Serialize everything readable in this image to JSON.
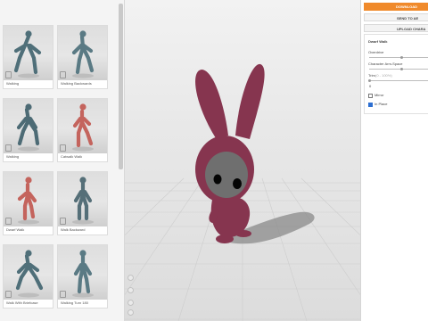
{
  "library": {
    "cards": [
      {
        "label": "Walking",
        "skin": "#4f6f79"
      },
      {
        "label": "Walking Backwards",
        "skin": "#5a7a84"
      },
      {
        "label": "Walking",
        "skin": "#4d6b75"
      },
      {
        "label": "Catwalk Walk",
        "skin": "#c4645d"
      },
      {
        "label": "Dwarf Walk",
        "skin": "#c4645d"
      },
      {
        "label": "Walk Backward",
        "skin": "#556f78"
      },
      {
        "label": "Walk With Briefcase",
        "skin": "#4f6f79"
      },
      {
        "label": "Walking Turn 180",
        "skin": "#5a7a84"
      }
    ]
  },
  "viewport": {
    "character_color": "#86354f",
    "face_color": "#6f6f6f"
  },
  "panel": {
    "download_label": "DOWNLOAD",
    "send_label": "SEND TO AE",
    "upload_label": "UPLOAD CHARA",
    "animation_title": "Dwarf Walk",
    "settings": [
      {
        "label": "Overdrive",
        "value": 0.5
      },
      {
        "label": "Character Arm-Space",
        "value": 0.5
      },
      {
        "label": "Trim",
        "value": 0.0
      }
    ],
    "trim_hint": "(0 - 100%)",
    "trim_value_text": "0",
    "mirror_label": "Mirror",
    "mirror_checked": false,
    "in_place_label": "In Place",
    "in_place_checked": true
  }
}
